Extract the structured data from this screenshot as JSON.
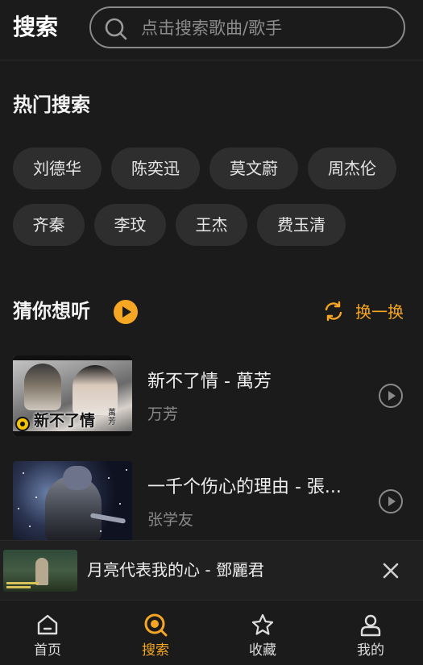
{
  "header": {
    "title": "搜索",
    "search_placeholder": "点击搜索歌曲/歌手"
  },
  "hot_search": {
    "title": "热门搜索",
    "tags": [
      "刘德华",
      "陈奕迅",
      "莫文蔚",
      "周杰伦",
      "齐秦",
      "李玟",
      "王杰",
      "费玉清"
    ]
  },
  "guess": {
    "title": "猜你想听",
    "refresh_label": "换一换",
    "songs": [
      {
        "title": "新不了情 - 萬芳",
        "artist": "万芳",
        "thumb_caption": "新不了情",
        "thumb_caption_sub": "萬芳"
      },
      {
        "title": "一千个伤心的理由 - 張...",
        "artist": "张学友"
      }
    ]
  },
  "mini_player": {
    "title": "月亮代表我的心 - 鄧麗君"
  },
  "tabbar": {
    "items": [
      {
        "label": "首页",
        "icon": "home-icon"
      },
      {
        "label": "搜索",
        "icon": "search-icon"
      },
      {
        "label": "收藏",
        "icon": "star-icon"
      },
      {
        "label": "我的",
        "icon": "user-icon"
      }
    ],
    "active_index": 1
  },
  "colors": {
    "accent": "#f5a623",
    "background": "#1b1b1b",
    "tag_bg": "#2e2e2e"
  }
}
